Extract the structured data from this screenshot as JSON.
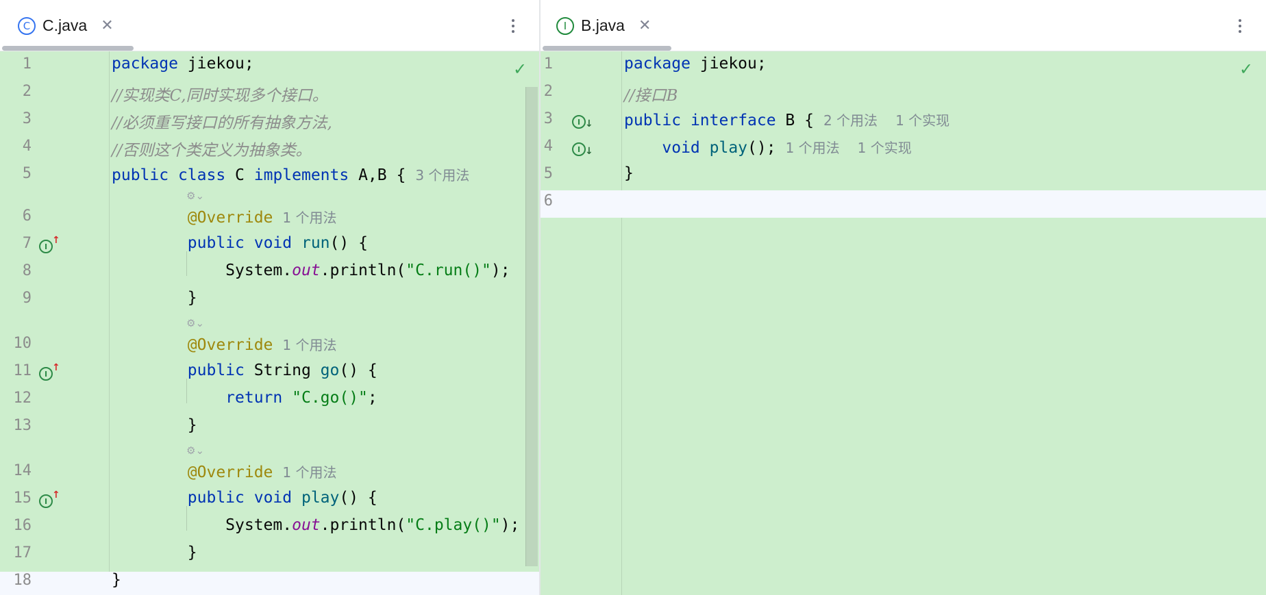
{
  "left": {
    "tab": {
      "title": "C.java",
      "icon": "class-icon",
      "icon_glyph": "C"
    },
    "lines": [
      {
        "n": "1",
        "tokens": [
          {
            "t": "package",
            "c": "kw"
          },
          {
            "t": " jiekou;",
            "c": ""
          }
        ]
      },
      {
        "n": "2",
        "tokens": [
          {
            "t": "//实现类C,同时实现多个接口。",
            "c": "cm"
          }
        ]
      },
      {
        "n": "3",
        "tokens": [
          {
            "t": "//必须重写接口的所有抽象方法,",
            "c": "cm"
          }
        ]
      },
      {
        "n": "4",
        "tokens": [
          {
            "t": "//否则这个类定义为抽象类。",
            "c": "cm"
          }
        ]
      },
      {
        "n": "5",
        "tokens": [
          {
            "t": "public",
            "c": "kw"
          },
          {
            "t": " ",
            "c": ""
          },
          {
            "t": "class",
            "c": "kw"
          },
          {
            "t": " C ",
            "c": ""
          },
          {
            "t": "implements",
            "c": "kw"
          },
          {
            "t": " A,B {",
            "c": ""
          }
        ],
        "hint": "3 个用法"
      },
      {
        "n": "6",
        "tokens": [
          {
            "t": "        ",
            "c": ""
          },
          {
            "t": "@Override",
            "c": "ann"
          }
        ],
        "hint": "1 个用法"
      },
      {
        "n": "7",
        "tokens": [
          {
            "t": "        ",
            "c": ""
          },
          {
            "t": "public",
            "c": "kw"
          },
          {
            "t": " ",
            "c": ""
          },
          {
            "t": "void",
            "c": "kw"
          },
          {
            "t": " ",
            "c": ""
          },
          {
            "t": "run",
            "c": "fn"
          },
          {
            "t": "() {",
            "c": ""
          }
        ]
      },
      {
        "n": "8",
        "tokens": [
          {
            "t": "            System.",
            "c": ""
          },
          {
            "t": "out",
            "c": "st"
          },
          {
            "t": ".println(",
            "c": ""
          },
          {
            "t": "\"C.run()\"",
            "c": "str"
          },
          {
            "t": ");",
            "c": ""
          }
        ]
      },
      {
        "n": "9",
        "tokens": [
          {
            "t": "        }",
            "c": ""
          }
        ]
      },
      {
        "n": "10",
        "tokens": [
          {
            "t": "        ",
            "c": ""
          },
          {
            "t": "@Override",
            "c": "ann"
          }
        ],
        "hint": "1 个用法"
      },
      {
        "n": "11",
        "tokens": [
          {
            "t": "        ",
            "c": ""
          },
          {
            "t": "public",
            "c": "kw"
          },
          {
            "t": " String ",
            "c": ""
          },
          {
            "t": "go",
            "c": "fn"
          },
          {
            "t": "() {",
            "c": ""
          }
        ]
      },
      {
        "n": "12",
        "tokens": [
          {
            "t": "            ",
            "c": ""
          },
          {
            "t": "return",
            "c": "kw"
          },
          {
            "t": " ",
            "c": ""
          },
          {
            "t": "\"C.go()\"",
            "c": "str"
          },
          {
            "t": ";",
            "c": ""
          }
        ]
      },
      {
        "n": "13",
        "tokens": [
          {
            "t": "        }",
            "c": ""
          }
        ]
      },
      {
        "n": "14",
        "tokens": [
          {
            "t": "        ",
            "c": ""
          },
          {
            "t": "@Override",
            "c": "ann"
          }
        ],
        "hint": "1 个用法"
      },
      {
        "n": "15",
        "tokens": [
          {
            "t": "        ",
            "c": ""
          },
          {
            "t": "public",
            "c": "kw"
          },
          {
            "t": " ",
            "c": ""
          },
          {
            "t": "void",
            "c": "kw"
          },
          {
            "t": " ",
            "c": ""
          },
          {
            "t": "play",
            "c": "fn"
          },
          {
            "t": "() {",
            "c": ""
          }
        ]
      },
      {
        "n": "16",
        "tokens": [
          {
            "t": "            System.",
            "c": ""
          },
          {
            "t": "out",
            "c": "st"
          },
          {
            "t": ".println(",
            "c": ""
          },
          {
            "t": "\"C.play()\"",
            "c": "str"
          },
          {
            "t": ");",
            "c": ""
          }
        ]
      },
      {
        "n": "17",
        "tokens": [
          {
            "t": "        }",
            "c": ""
          }
        ]
      },
      {
        "n": "18",
        "tokens": [
          {
            "t": "}",
            "c": ""
          }
        ]
      }
    ]
  },
  "right": {
    "tab": {
      "title": "B.java",
      "icon": "interface-icon",
      "icon_glyph": "I"
    },
    "lines": [
      {
        "n": "1",
        "tokens": [
          {
            "t": "package",
            "c": "kw"
          },
          {
            "t": " jiekou;",
            "c": ""
          }
        ]
      },
      {
        "n": "2",
        "tokens": [
          {
            "t": "//接口B",
            "c": "cm"
          }
        ]
      },
      {
        "n": "3",
        "tokens": [
          {
            "t": "public",
            "c": "kw"
          },
          {
            "t": " ",
            "c": ""
          },
          {
            "t": "interface",
            "c": "kw"
          },
          {
            "t": " B {",
            "c": ""
          }
        ],
        "hint": "2 个用法",
        "hint2": "1 个实现"
      },
      {
        "n": "4",
        "tokens": [
          {
            "t": "    ",
            "c": ""
          },
          {
            "t": "void",
            "c": "kw"
          },
          {
            "t": " ",
            "c": ""
          },
          {
            "t": "play",
            "c": "fn"
          },
          {
            "t": "();",
            "c": ""
          }
        ],
        "hint": "1 个用法",
        "hint2": "1 个实现"
      },
      {
        "n": "5",
        "tokens": [
          {
            "t": "}",
            "c": ""
          }
        ]
      },
      {
        "n": "6",
        "tokens": []
      }
    ]
  },
  "gutter_icons": {
    "implementing_method": "implements-method-up-icon",
    "implemented_member": "implemented-down-icon",
    "inspection_ok": "check-icon",
    "inlay_hint": "ai-hint-fold-icon"
  },
  "colors": {
    "diff_bg": "#cdeecd",
    "keyword": "#0033b3",
    "string": "#067d17",
    "annotation": "#9e880d",
    "comment": "#8c8c8c",
    "method": "#00627a"
  }
}
